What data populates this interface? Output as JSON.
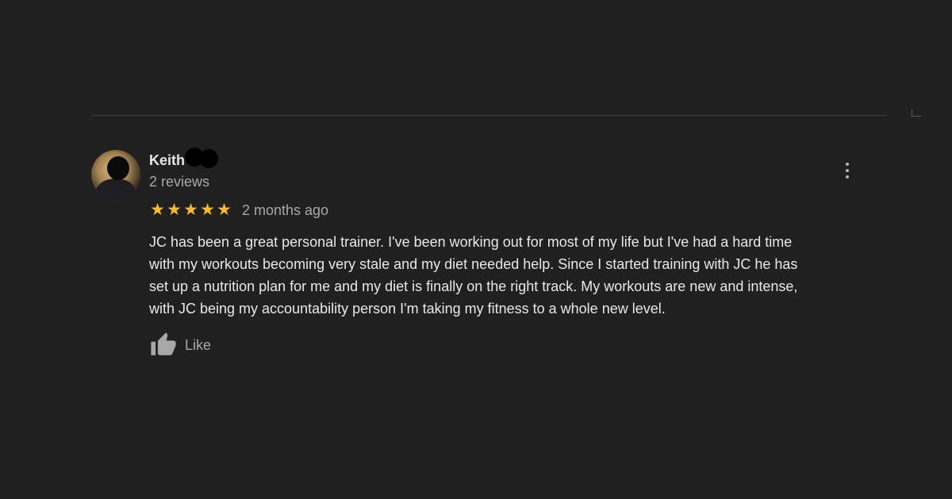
{
  "review": {
    "author_name": "Keith",
    "review_count": "2 reviews",
    "rating": 5,
    "rating_max": 5,
    "date": "2 months ago",
    "text": "JC has been a great personal trainer. I've been  working out for most of my life but I've had a hard time\nwith my workouts becoming very stale and my diet needed help. Since I started training with JC he has\nset up a nutrition plan for me and my diet is finally on the right track. My workouts are new and intense,\nwith JC being my accountability person I'm taking my fitness to a whole new level.",
    "like_label": "Like",
    "menu_icon": "more-vert-icon",
    "like_icon": "thumbs-up-icon"
  },
  "colors": {
    "background": "#202020",
    "star": "#f6bb2b",
    "primary_text": "#e8e8e8",
    "secondary_text": "#a8a8a8"
  }
}
